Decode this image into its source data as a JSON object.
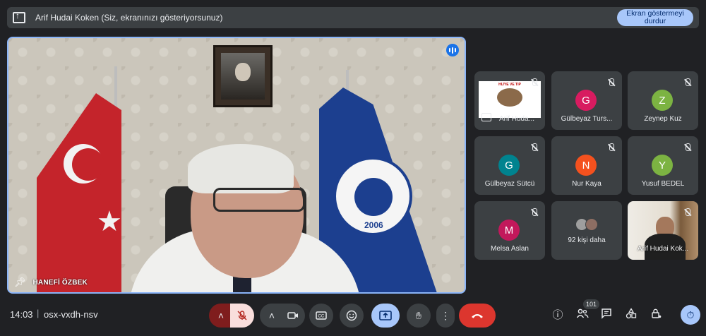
{
  "banner": {
    "text": "Arif Hudai Koken (Siz, ekranınızı gösteriyorsunuz)",
    "stop_label": "Ekran göstermeyi durdur"
  },
  "main": {
    "speaker_name": "HANEFİ ÖZBEK",
    "seal_year": "2006"
  },
  "participants": [
    {
      "name": "Arif Huda...",
      "type": "screen",
      "preview_title": "HIJYE VE TIP"
    },
    {
      "name": "Gülbeyaz Turs...",
      "initial": "G",
      "color": "#d81b60"
    },
    {
      "name": "Zeynep Kuz",
      "initial": "Z",
      "color": "#7cb342"
    },
    {
      "name": "Gülbeyaz Sütcü",
      "initial": "G",
      "color": "#00838f"
    },
    {
      "name": "Nur Kaya",
      "initial": "N",
      "color": "#f4511e"
    },
    {
      "name": "Yusuf BEDEL",
      "initial": "Y",
      "color": "#7cb342"
    },
    {
      "name": "Melsa Aslan",
      "initial": "M",
      "color": "#c2185b"
    },
    {
      "name": "92 kişi daha",
      "type": "more"
    },
    {
      "name": "Arif Hudai Kok...",
      "type": "camera"
    }
  ],
  "bottom": {
    "time": "14:03",
    "separator": "|",
    "meeting_code": "osx-vxdh-nsv",
    "participant_count": "101"
  },
  "icons": {
    "mic_off": "mic-off-icon",
    "camera": "camera-icon",
    "captions": "captions-icon",
    "emoji": "emoji-icon",
    "present": "present-icon",
    "raise_hand": "raise-hand-icon",
    "more": "more-options-icon",
    "end_call": "end-call-icon",
    "info": "info-icon",
    "people": "people-icon",
    "chat": "chat-icon",
    "activities": "activities-icon",
    "host_controls": "host-controls-icon",
    "timer": "timer-icon"
  }
}
